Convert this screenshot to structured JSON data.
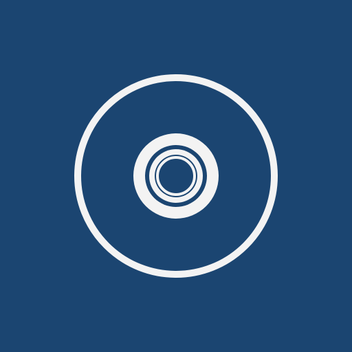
{
  "app_icon": {
    "icon": "disc-icon",
    "colors": {
      "background": "#1b4571",
      "foreground": "#f3f3f3"
    }
  }
}
